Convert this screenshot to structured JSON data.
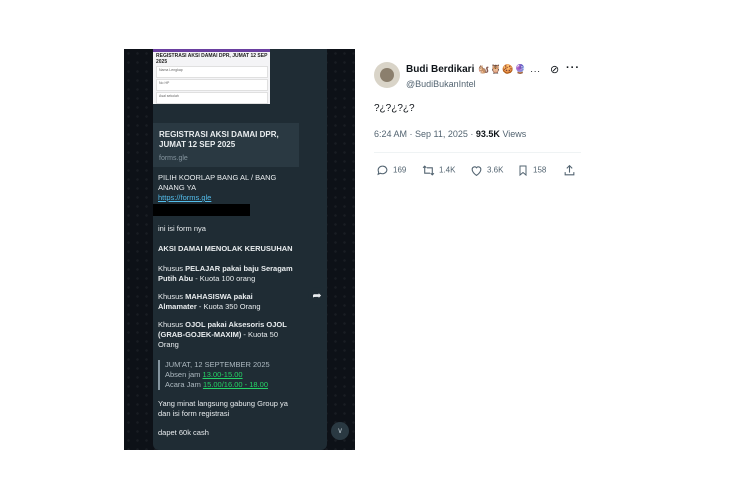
{
  "media": {
    "preview_title": "REGISTRASI AKSI DAMAI DPR, JUMAT 12 SEP 2025",
    "preview_rows": [
      "Nama Lengkap",
      "No HP",
      "Asal sekolah"
    ],
    "link_card": {
      "title": "REGISTRASI AKSI DAMAI DPR, JUMAT 12 SEP 2025",
      "domain": "forms.gle"
    },
    "msg1": "PILIH KOORLAP BANG AL / BANG ANANG YA",
    "msg1_link": "https://forms.gle",
    "line_isi": "ini isi form nya",
    "heading": "AKSI DAMAI MENOLAK KERUSUHAN",
    "pelajar_pre": "Khusus ",
    "pelajar_bold": "PELAJAR pakai baju Seragam Putih Abu",
    "pelajar_post": " - Kuota 100 orang",
    "mhs_pre": "Khusus ",
    "mhs_bold": "MAHASISWA pakai Almamater",
    "mhs_post": " - Kuota 350 Orang",
    "ojol_pre": "Khusus ",
    "ojol_bold": "OJOL pakai Aksesoris OJOL (GRAB-GOJEK-MAXIM)",
    "ojol_post": " - Kuota 50 Orang",
    "date_line": "JUM'AT, 12 SEPTEMBER 2025",
    "absen_pre": "Absen jam ",
    "absen_time": "13.00-15.00",
    "acara_pre": "Acara Jam ",
    "acara_time": "15.00/16.00 - 18.00",
    "join": "Yang minat langsung gabung Group ya dan isi form registrasi",
    "cash": "dapet 60k cash"
  },
  "tweet": {
    "name": "Budi Berdikari",
    "emojis": "🐿️🦉🍪🔮 ...",
    "handle": "@BudiBukanIntel",
    "text": "?¿?¿?¿?",
    "time": "6:24 AM · Sep 11, 2025 · ",
    "views_count": "93.5K",
    "views_label": " Views",
    "replies": "169",
    "reposts": "1.4K",
    "likes": "3.6K",
    "bookmarks": "158"
  },
  "icons": [
    "forward-icon",
    "scroll-down-icon",
    "grok-icon",
    "more-icon",
    "reply-icon",
    "repost-icon",
    "like-icon",
    "bookmark-icon",
    "share-icon"
  ]
}
